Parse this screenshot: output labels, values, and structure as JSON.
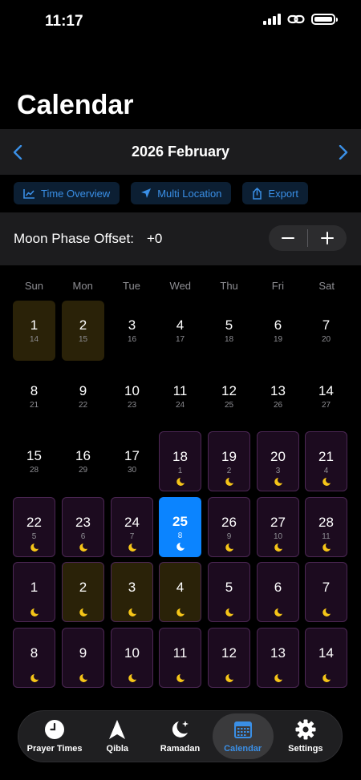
{
  "status_bar": {
    "time": "11:17"
  },
  "page_title": "Calendar",
  "month_nav": {
    "label": "2026 February"
  },
  "actions": [
    {
      "label": "Time Overview",
      "icon": "chart-icon"
    },
    {
      "label": "Multi Location",
      "icon": "location-arrow-icon"
    },
    {
      "label": "Export",
      "icon": "share-icon"
    }
  ],
  "moon_offset": {
    "label": "Moon Phase Offset:",
    "value": "+0"
  },
  "weekdays": [
    "Sun",
    "Mon",
    "Tue",
    "Wed",
    "Thu",
    "Fri",
    "Sat"
  ],
  "weeks": [
    [
      {
        "g": "1",
        "h": "14",
        "style": "tint"
      },
      {
        "g": "2",
        "h": "15",
        "style": "tint"
      },
      {
        "g": "3",
        "h": "16",
        "style": "plain"
      },
      {
        "g": "4",
        "h": "17",
        "style": "plain"
      },
      {
        "g": "5",
        "h": "18",
        "style": "plain"
      },
      {
        "g": "6",
        "h": "19",
        "style": "plain"
      },
      {
        "g": "7",
        "h": "20",
        "style": "plain"
      }
    ],
    [
      {
        "g": "8",
        "h": "21",
        "style": "plain"
      },
      {
        "g": "9",
        "h": "22",
        "style": "plain"
      },
      {
        "g": "10",
        "h": "23",
        "style": "plain"
      },
      {
        "g": "11",
        "h": "24",
        "style": "plain"
      },
      {
        "g": "12",
        "h": "25",
        "style": "plain"
      },
      {
        "g": "13",
        "h": "26",
        "style": "plain"
      },
      {
        "g": "14",
        "h": "27",
        "style": "plain"
      }
    ],
    [
      {
        "g": "15",
        "h": "28",
        "style": "plain"
      },
      {
        "g": "16",
        "h": "29",
        "style": "plain"
      },
      {
        "g": "17",
        "h": "30",
        "style": "plain"
      },
      {
        "g": "18",
        "h": "1",
        "style": "ram",
        "moon": true
      },
      {
        "g": "19",
        "h": "2",
        "style": "ram",
        "moon": true
      },
      {
        "g": "20",
        "h": "3",
        "style": "ram",
        "moon": true
      },
      {
        "g": "21",
        "h": "4",
        "style": "ram",
        "moon": true
      }
    ],
    [
      {
        "g": "22",
        "h": "5",
        "style": "ram",
        "moon": true
      },
      {
        "g": "23",
        "h": "6",
        "style": "ram",
        "moon": true
      },
      {
        "g": "24",
        "h": "7",
        "style": "ram",
        "moon": true
      },
      {
        "g": "25",
        "h": "8",
        "style": "today",
        "moon": true
      },
      {
        "g": "26",
        "h": "9",
        "style": "ram",
        "moon": true
      },
      {
        "g": "27",
        "h": "10",
        "style": "ram",
        "moon": true
      },
      {
        "g": "28",
        "h": "11",
        "style": "ram",
        "moon": true
      }
    ],
    [
      {
        "g": "1",
        "h": "",
        "style": "ram",
        "moon": true
      },
      {
        "g": "2",
        "h": "",
        "style": "ram-tint",
        "moon": true
      },
      {
        "g": "3",
        "h": "",
        "style": "ram-tint",
        "moon": true
      },
      {
        "g": "4",
        "h": "",
        "style": "ram-tint",
        "moon": true
      },
      {
        "g": "5",
        "h": "",
        "style": "ram",
        "moon": true
      },
      {
        "g": "6",
        "h": "",
        "style": "ram",
        "moon": true
      },
      {
        "g": "7",
        "h": "",
        "style": "ram",
        "moon": true
      }
    ],
    [
      {
        "g": "8",
        "h": "",
        "style": "ram",
        "moon": true
      },
      {
        "g": "9",
        "h": "",
        "style": "ram",
        "moon": true
      },
      {
        "g": "10",
        "h": "",
        "style": "ram",
        "moon": true
      },
      {
        "g": "11",
        "h": "",
        "style": "ram",
        "moon": true
      },
      {
        "g": "12",
        "h": "",
        "style": "ram",
        "moon": true
      },
      {
        "g": "13",
        "h": "",
        "style": "ram",
        "moon": true
      },
      {
        "g": "14",
        "h": "",
        "style": "ram",
        "moon": true
      }
    ]
  ],
  "tabs": [
    {
      "label": "Prayer Times",
      "icon": "clock-icon",
      "active": false
    },
    {
      "label": "Qibla",
      "icon": "compass-arrow-icon",
      "active": false
    },
    {
      "label": "Ramadan",
      "icon": "moon-stars-icon",
      "active": false
    },
    {
      "label": "Calendar",
      "icon": "calendar-icon",
      "active": true
    },
    {
      "label": "Settings",
      "icon": "gear-icon",
      "active": false
    }
  ],
  "colors": {
    "accent": "#0b84ff",
    "link": "#3a8fe6",
    "moon": "#f5c518",
    "ramadan_bg": "#1c0b1f",
    "ramadan_border": "#4c2754",
    "eid_bg": "#2a2208"
  }
}
